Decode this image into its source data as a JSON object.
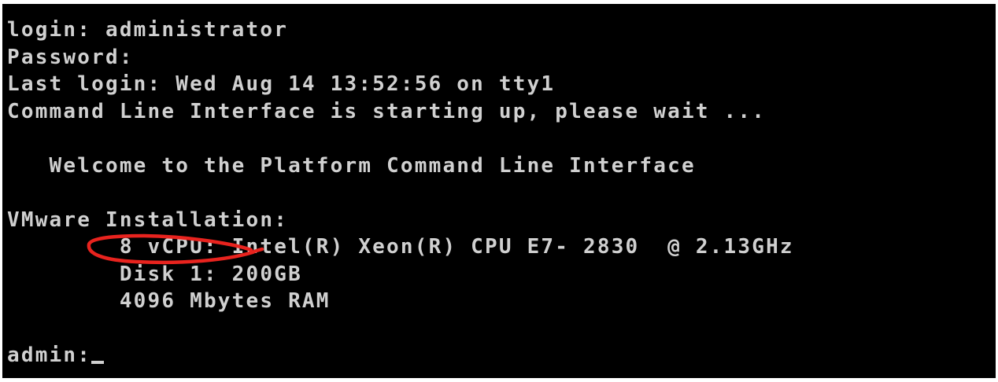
{
  "console": {
    "lines": [
      "login: administrator",
      "Password:",
      "Last login: Wed Aug 14 13:52:56 on tty1",
      "Command Line Interface is starting up, please wait ...",
      "",
      "   Welcome to the Platform Command Line Interface",
      "",
      "VMware Installation:",
      "        8 vCPU: Intel(R) Xeon(R) CPU E7- 2830  @ 2.13GHz",
      "        Disk 1: 200GB",
      "        4096 Mbytes RAM",
      ""
    ],
    "prompt": "admin:",
    "input_value": ""
  },
  "annotation": {
    "color": "#e8231e",
    "shape": "hand-drawn ellipse around vCPU count"
  },
  "colors": {
    "background": "#000000",
    "text": "#d0d0d0",
    "frame": "#ffffff"
  }
}
